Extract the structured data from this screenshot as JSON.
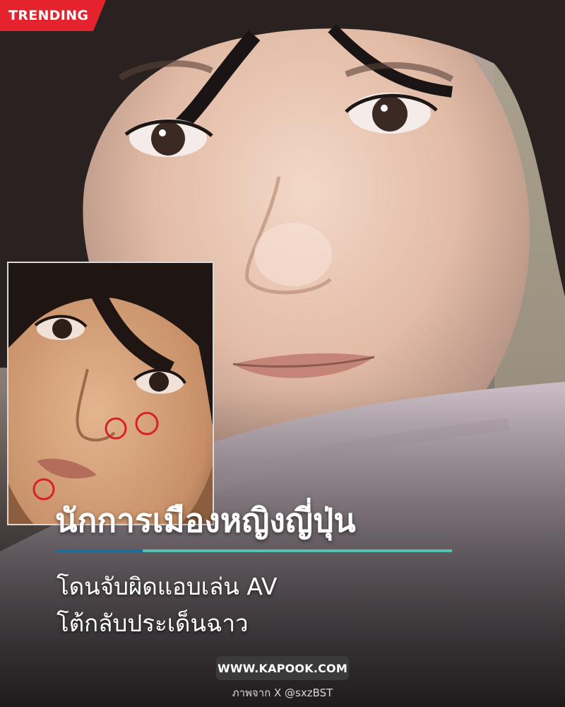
{
  "badge": {
    "label": "TRENDING",
    "color": "#e5232e"
  },
  "headline": {
    "title": "นักการเมืองหญิงญี่ปุ่น",
    "line2": "โดนจับผิดแอบเล่น AV",
    "line3": "โต้กลับประเด็นฉาว"
  },
  "accent": {
    "underline": "#4dc3b2",
    "underline_highlight": "#1f6b9a"
  },
  "footer": {
    "site": "WWW.KAPOOK.COM",
    "credit": "ภาพจาก X @sxzBST"
  }
}
